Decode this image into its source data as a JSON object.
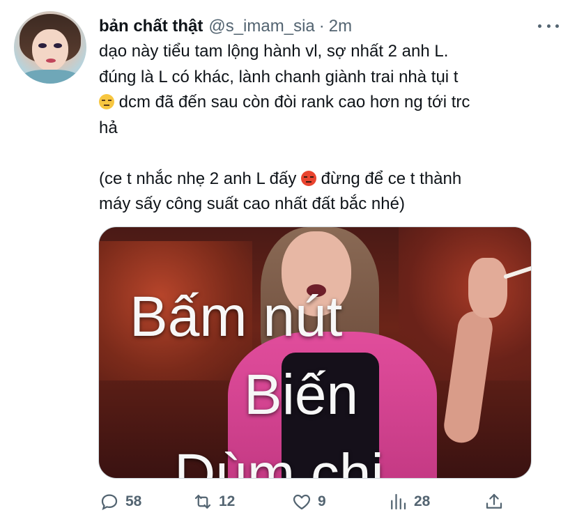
{
  "tweet": {
    "display_name": "bản chất thật",
    "handle": "@s_imam_sia",
    "separator": "·",
    "timestamp": "2m",
    "body": {
      "line1": "dạo này tiểu tam lộng hành vl, sợ nhất 2 anh L.",
      "line2": "đúng là L có khác, lành chanh giành trai nhà tụi t",
      "line3": " dcm đã đến sau còn đòi rank cao hơn ng tới trc",
      "line4": "hả",
      "line5a": "(ce t nhắc nhẹ 2 anh L đấy ",
      "line5b": " đừng để ce t thành",
      "line6": "máy sấy công suất cao nhất đất bắc nhé)"
    },
    "media": {
      "caption_line1": "Bấm nút",
      "caption_line2": "Biến",
      "caption_line3": "Dùm chị"
    },
    "actions": {
      "reply_count": "58",
      "retweet_count": "12",
      "like_count": "9",
      "analytics_count": "28"
    }
  },
  "icons": {
    "more": "more-horizontal-icon",
    "reply": "reply-icon",
    "retweet": "retweet-icon",
    "like": "heart-icon",
    "analytics": "analytics-icon",
    "share": "share-icon",
    "emoji1": "unamused-face-emoji",
    "emoji2": "angry-face-emoji"
  },
  "colors": {
    "text": "#0f1419",
    "secondary": "#536471"
  }
}
